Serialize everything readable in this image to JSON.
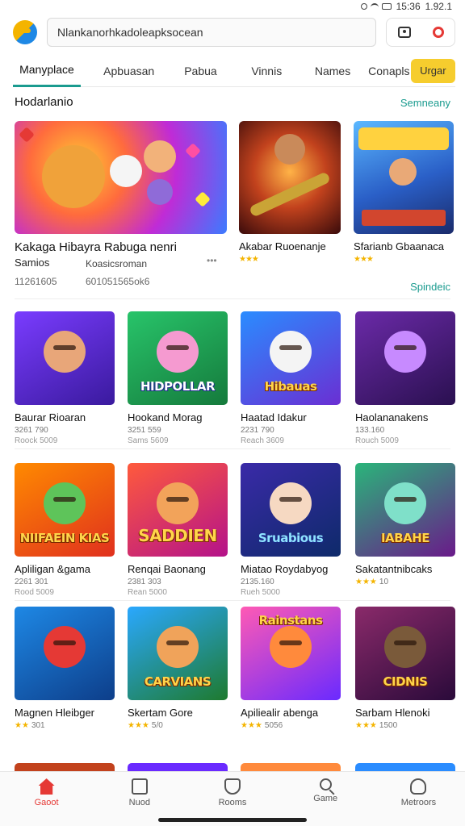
{
  "status": {
    "time": "15:36",
    "battery": "1.92.1"
  },
  "search": {
    "value": "Nlankanorhkadoleapksocean"
  },
  "tabs": [
    {
      "label": "Manyplace",
      "active": true
    },
    {
      "label": "Apbuasan"
    },
    {
      "label": "Pabua"
    },
    {
      "label": "Vinnis"
    },
    {
      "label": "Names"
    },
    {
      "label": "Conapls"
    }
  ],
  "order_button": "Urgar",
  "section": {
    "title": "Hodarlanio",
    "link": "Semneany"
  },
  "featured": [
    {
      "name": "Kakaga Hibayra Rabuga nenri",
      "sub": "Samios",
      "sub2": "Koasicsroman",
      "meta": "11261605",
      "meta2": "601051565ok6",
      "more": "•••"
    },
    {
      "name": "Akabar Ruoenanje",
      "stars": "★★★",
      "rating": ""
    },
    {
      "name": "Sfarianb Gbaanaca",
      "stars": "★★★",
      "rating": ""
    }
  ],
  "featured_link": "Spindeic",
  "rows": [
    [
      {
        "name": "Baurar Rioaran",
        "meta1": "3261 790",
        "meta2": "Roock 5009",
        "thumb_text": ""
      },
      {
        "name": "Hookand Morag",
        "meta1": "3251 559",
        "meta2": "Sams 5609",
        "thumb_text": "HIDPOLLAR"
      },
      {
        "name": "Haatad Idakur",
        "meta1": "2231 790",
        "meta2": "Reach 3609",
        "thumb_text": "Hibauas"
      },
      {
        "name": "Haolananakens",
        "meta1": "133.160",
        "meta2": "Rouch 5009",
        "thumb_text": ""
      }
    ],
    [
      {
        "name": "Apliligan &gama",
        "meta1": "2261 301",
        "meta2": "Rood 5009",
        "thumb_text": "NIIFAEIN KIAS"
      },
      {
        "name": "Renqai Baonang",
        "meta1": "2381 303",
        "meta2": "Rean 5000",
        "thumb_text": "SADDIEN"
      },
      {
        "name": "Miatao Roydabyog",
        "meta1": "2135.160",
        "meta2": "Rueh 5000",
        "thumb_text": "Sruabious"
      },
      {
        "name": "Sakatantnibcaks",
        "stars": "★★★",
        "rating": "10",
        "thumb_text": "IABAHE"
      }
    ],
    [
      {
        "name": "Magnen Hleibger",
        "stars": "★★",
        "rating": "301",
        "thumb_text": ""
      },
      {
        "name": "Skertam Gore",
        "stars": "★★★",
        "rating": "5/0",
        "thumb_text": "CARVIANS"
      },
      {
        "name": "Apiliealir abenga",
        "stars": "★★★",
        "rating": "5056",
        "thumb_text": "Rainstans"
      },
      {
        "name": "Sarbam Hlenoki",
        "stars": "★★★",
        "rating": "1500",
        "thumb_text": "CIDNIS"
      }
    ]
  ],
  "bottom_nav": [
    {
      "label": "Gaoot",
      "icon": "home-icon",
      "active": true
    },
    {
      "label": "Nuod",
      "icon": "box-icon"
    },
    {
      "label": "Rooms",
      "icon": "shield-icon"
    },
    {
      "label": "Game",
      "icon": "search-icon"
    },
    {
      "label": "Metroors",
      "icon": "user-icon"
    }
  ],
  "colors": {
    "accent": "#1a9b8f",
    "order": "#f6cd2e",
    "active_nav": "#e53935",
    "stars": "#f4b400"
  }
}
